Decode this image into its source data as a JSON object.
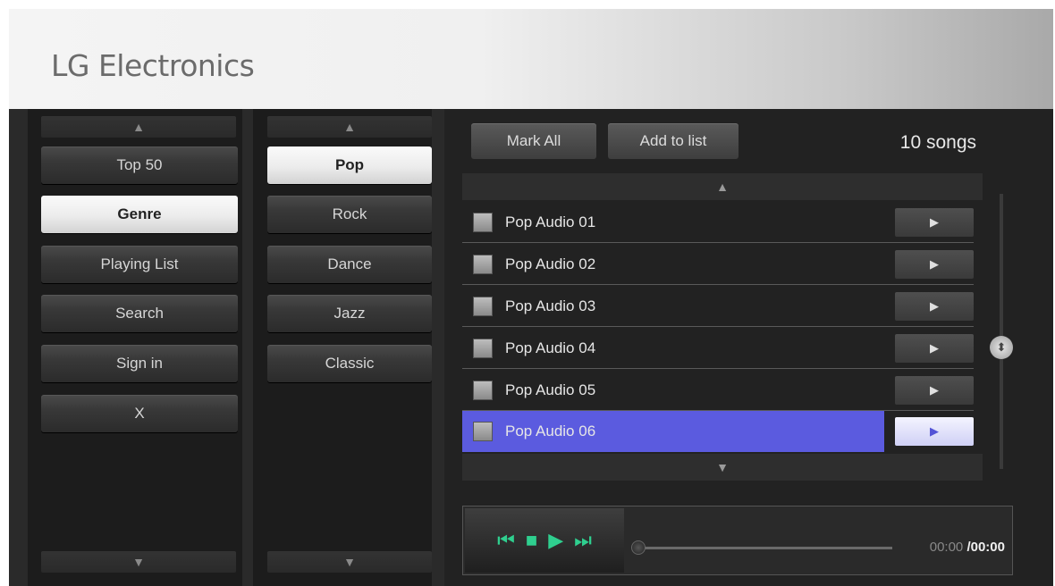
{
  "header": {
    "brand": "LG Electronics"
  },
  "nav": {
    "items": [
      {
        "label": "Top 50",
        "active": false
      },
      {
        "label": "Genre",
        "active": true
      },
      {
        "label": "Playing List",
        "active": false
      },
      {
        "label": "Search",
        "active": false
      },
      {
        "label": "Sign in",
        "active": false
      },
      {
        "label": "X",
        "active": false
      }
    ]
  },
  "genres": {
    "items": [
      {
        "label": "Pop",
        "active": true
      },
      {
        "label": "Rock",
        "active": false
      },
      {
        "label": "Dance",
        "active": false
      },
      {
        "label": "Jazz",
        "active": false
      },
      {
        "label": "Classic",
        "active": false
      }
    ]
  },
  "toolbar": {
    "mark_all": "Mark All",
    "add_to_list": "Add to list",
    "count": "10 songs"
  },
  "songs": [
    {
      "title": "Pop Audio 01",
      "selected": false
    },
    {
      "title": "Pop Audio 02",
      "selected": false
    },
    {
      "title": "Pop Audio 03",
      "selected": false
    },
    {
      "title": "Pop Audio 04",
      "selected": false
    },
    {
      "title": "Pop Audio 05",
      "selected": false
    },
    {
      "title": "Pop Audio 06",
      "selected": true
    }
  ],
  "icons": {
    "up": "▲",
    "down": "▼",
    "play": "▶",
    "prev": "⏮",
    "stop": "■",
    "next": "⏭",
    "scroll": "⬍"
  },
  "player": {
    "current_time": "00:00",
    "total_time": "/00:00"
  },
  "colors": {
    "selected_row": "#5b5bdf",
    "player_controls": "#2fcf8f"
  }
}
